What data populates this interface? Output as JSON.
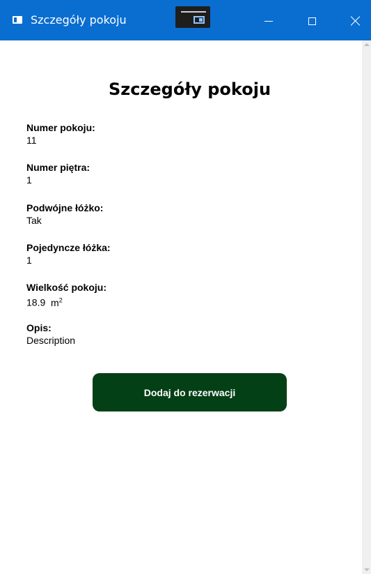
{
  "window": {
    "title": "Szczegóły pokoju",
    "accent_color": "#0a6ed1"
  },
  "page": {
    "heading": "Szczegóły pokoju"
  },
  "fields": [
    {
      "label": "Numer pokoju:",
      "value": "11"
    },
    {
      "label": "Numer piętra:",
      "value": "1"
    },
    {
      "label": "Podwójne łóżko:",
      "value": "Tak"
    },
    {
      "label": "Pojedyncze łóżka:",
      "value": "1"
    },
    {
      "label": "Wielkość pokoju:",
      "value": "18.9",
      "unit": "m",
      "unit_sup": "2"
    },
    {
      "label": "Opis:",
      "value": "Description"
    }
  ],
  "actions": {
    "add_label": "Dodaj do rezerwacji",
    "add_color": "#044015"
  },
  "icons": {
    "app": "window-app-icon",
    "snap": "snap-layout-icon",
    "minimize": "minimize-icon",
    "maximize": "maximize-icon",
    "close": "close-icon"
  }
}
